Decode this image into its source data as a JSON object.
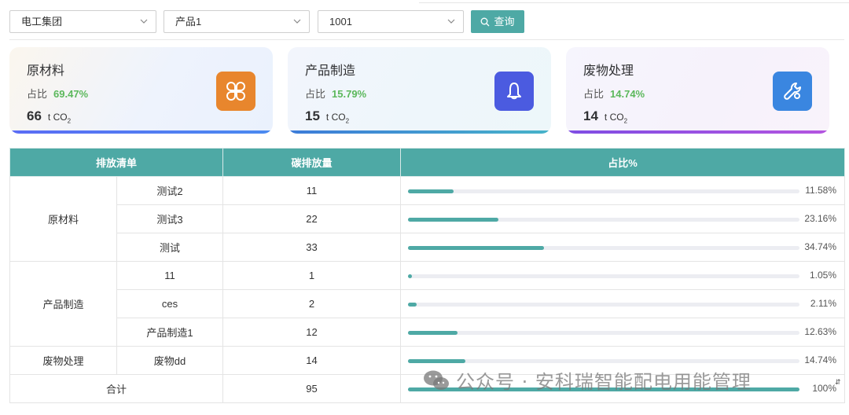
{
  "filters": {
    "company": "电工集团",
    "product": "产品1",
    "code": "1001",
    "query_label": "查询"
  },
  "cards": [
    {
      "title": "原材料",
      "ratio_label": "占比",
      "ratio": "69.47%",
      "value": "66",
      "unit": "t CO",
      "unit_sub": "2",
      "icon": "clover-icon",
      "icon_color": "#e8862d"
    },
    {
      "title": "产品制造",
      "ratio_label": "占比",
      "ratio": "15.79%",
      "value": "15",
      "unit": "t CO",
      "unit_sub": "2",
      "icon": "bell-icon",
      "icon_color": "#4b5be0"
    },
    {
      "title": "废物处理",
      "ratio_label": "占比",
      "ratio": "14.74%",
      "value": "14",
      "unit": "t CO",
      "unit_sub": "2",
      "icon": "wrench-icon",
      "icon_color": "#3a86e0"
    }
  ],
  "table": {
    "headers": [
      "排放清单",
      "碳排放量",
      "占比%"
    ],
    "groups": [
      {
        "name": "原材料",
        "rows": [
          {
            "item": "测试2",
            "amount": "11",
            "pct": "11.58%",
            "fraction": 0.1158
          },
          {
            "item": "测试3",
            "amount": "22",
            "pct": "23.16%",
            "fraction": 0.2316
          },
          {
            "item": "测试",
            "amount": "33",
            "pct": "34.74%",
            "fraction": 0.3474
          }
        ]
      },
      {
        "name": "产品制造",
        "rows": [
          {
            "item": "11",
            "amount": "1",
            "pct": "1.05%",
            "fraction": 0.0105
          },
          {
            "item": "ces",
            "amount": "2",
            "pct": "2.11%",
            "fraction": 0.0211
          },
          {
            "item": "产品制造1",
            "amount": "12",
            "pct": "12.63%",
            "fraction": 0.1263
          }
        ]
      },
      {
        "name": "废物处理",
        "rows": [
          {
            "item": "废物dd",
            "amount": "14",
            "pct": "14.74%",
            "fraction": 0.1474
          }
        ]
      }
    ],
    "total": {
      "label": "合计",
      "amount": "95",
      "pct": "100%",
      "fraction": 1.0
    }
  },
  "watermark": "公众号 · 安科瑞智能配电用能管理",
  "colors": {
    "accent": "#4ea9a5",
    "ratio_green": "#5cb85c"
  }
}
